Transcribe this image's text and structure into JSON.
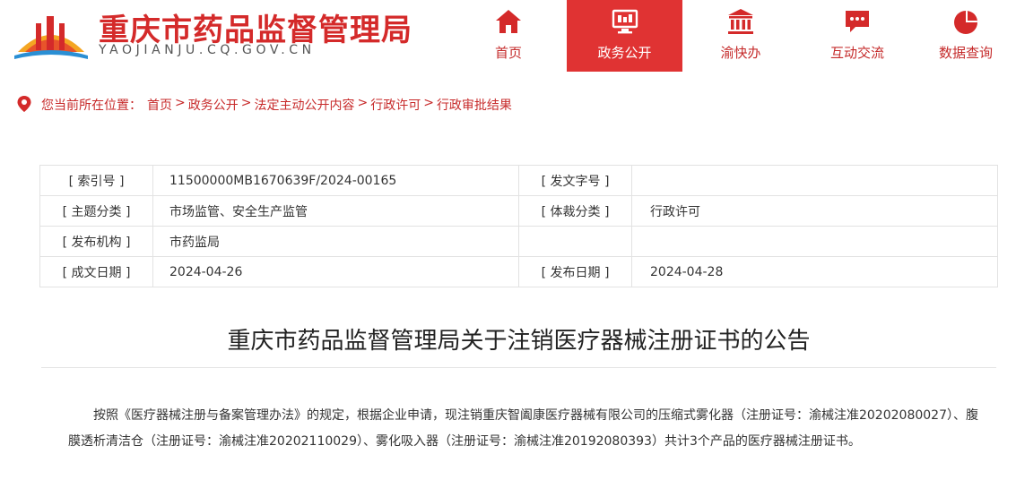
{
  "header": {
    "site_title": "重庆市药品监督管理局",
    "site_subtitle": "YAOJIANJU.CQ.GOV.CN",
    "brand_color": "#d42a2a"
  },
  "nav": {
    "items": [
      {
        "label": "首页",
        "icon": "home-icon",
        "active": false
      },
      {
        "label": "政务公开",
        "icon": "monitor-icon",
        "active": true
      },
      {
        "label": "渝快办",
        "icon": "building-icon",
        "active": false
      },
      {
        "label": "互动交流",
        "icon": "chat-icon",
        "active": false
      },
      {
        "label": "数据查询",
        "icon": "pie-chart-icon",
        "active": false
      }
    ]
  },
  "breadcrumb": {
    "prefix": "您当前所在位置：",
    "items": [
      "首页",
      "政务公开",
      "法定主动公开内容",
      "行政许可",
      "行政审批结果"
    ],
    "separator": ">"
  },
  "info": {
    "index_label": "[ 索引号 ]",
    "index_value": "11500000MB1670639F/2024-00165",
    "doc_no_label": "[ 发文字号 ]",
    "doc_no_value": "",
    "topic_label": "[ 主题分类 ]",
    "topic_value": "市场监管、安全生产监管",
    "genre_label": "[ 体裁分类 ]",
    "genre_value": "行政许可",
    "org_label": "[ 发布机构 ]",
    "org_value": "市药监局",
    "created_label": "[ 成文日期 ]",
    "created_value": "2024-04-26",
    "published_label": "[ 发布日期 ]",
    "published_value": "2024-04-28"
  },
  "article": {
    "title": "重庆市药品监督管理局关于注销医疗器械注册证书的公告",
    "body": "按照《医疗器械注册与备案管理办法》的规定，根据企业申请，现注销重庆智阖康医疗器械有限公司的压缩式雾化器（注册证号：渝械注准20202080027）、腹膜透析清洁仓（注册证号：渝械注准20202110029）、雾化吸入器（注册证号：渝械注准20192080393）共计3个产品的医疗器械注册证书。"
  }
}
